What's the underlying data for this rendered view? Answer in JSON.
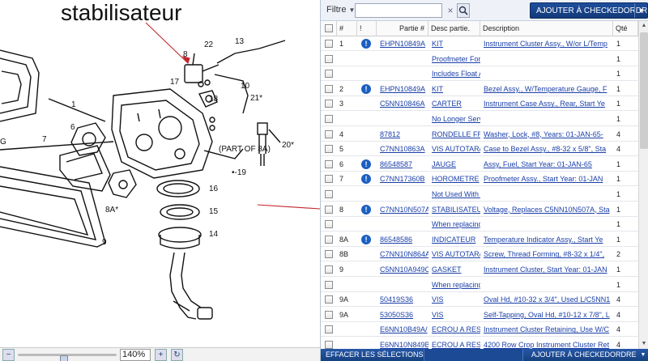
{
  "left": {
    "annotation": "stabilisateur",
    "diagram_labels": [
      "22",
      "13",
      "8",
      "17",
      "10",
      "21*",
      "1",
      "18",
      "6",
      "7",
      "20*",
      "(PART OF 8A)",
      "8A*",
      "16",
      "15",
      "14",
      "9",
      "19",
      "G"
    ],
    "zoom": {
      "value": "140%",
      "zoom_out_icon": "magnifier-minus-icon",
      "zoom_in_icon": "magnifier-plus-icon",
      "refresh_icon": "refresh-icon"
    }
  },
  "toolbar": {
    "filter_label": "Filtre",
    "search_value": "",
    "clear_icon": "×",
    "search_icon": "magnifier-icon",
    "add_to_checkout_label": "AJOUTER À CHECKEDORDRE"
  },
  "columns": [
    "#",
    "!",
    "Partie #",
    "Desc partie.",
    "Description",
    "Qté"
  ],
  "rows": [
    {
      "num": "1",
      "info": true,
      "part": "EHPN10849A",
      "desc": "KIT",
      "description": "Instrument Cluster Assy., W/or L/Temp",
      "qty": "1"
    },
    {
      "num": "",
      "info": false,
      "part": "",
      "desc": "Proofmeter For",
      "description": "",
      "qty": "1"
    },
    {
      "num": "",
      "info": false,
      "part": "",
      "desc": "Includes Float A",
      "description": "",
      "qty": "1"
    },
    {
      "num": "2",
      "info": true,
      "part": "EHPN10849A",
      "desc": "KIT",
      "description": "Bezel Assy., W/Temperature Gauge, F",
      "qty": "1"
    },
    {
      "num": "3",
      "info": false,
      "part": "C5NN10846A",
      "desc": "CARTER",
      "description": "Instrument Case Assy., Rear, Start Ye",
      "qty": "1"
    },
    {
      "num": "",
      "info": false,
      "part": "",
      "desc": "No Longer Serv",
      "description": "",
      "qty": "1"
    },
    {
      "num": "4",
      "info": false,
      "part": "87812",
      "desc": "RONDELLE FRE",
      "description": "Washer, Lock, #8, Years: 01-JAN-65-",
      "qty": "4"
    },
    {
      "num": "5",
      "info": false,
      "part": "C7NN10863A",
      "desc": "VIS AUTOTAR/",
      "description": "Case to Bezel Assy., #8-32 x 5/8\", Sta",
      "qty": "4"
    },
    {
      "num": "6",
      "info": true,
      "part": "86548587",
      "desc": "JAUGE",
      "description": "Assy, Fuel, Start Year: 01-JAN-65",
      "qty": "1"
    },
    {
      "num": "7",
      "info": true,
      "part": "C7NN17360B",
      "desc": "HOROMETRE",
      "description": "Proofmeter Assy., Start Year: 01-JAN",
      "qty": "1"
    },
    {
      "num": "",
      "info": false,
      "part": "",
      "desc": "Not Used With (",
      "description": "",
      "qty": "1"
    },
    {
      "num": "8",
      "info": true,
      "part": "C7NN10N507A",
      "desc": "STABILISATEUI",
      "description": "Voltage, Replaces C5NN10N507A, Sta",
      "qty": "1"
    },
    {
      "num": "",
      "info": false,
      "part": "",
      "desc": "When replacing",
      "description": "",
      "qty": "1"
    },
    {
      "num": "8A",
      "info": true,
      "part": "86548586",
      "desc": "INDICATEUR",
      "description": "Temperature Indicator Assy., Start Ye",
      "qty": "1"
    },
    {
      "num": "8B",
      "info": false,
      "part": "C7NN10N864A",
      "desc": "VIS AUTOTAR/",
      "description": "Screw, Thread Forming, #8-32 x 1/4\",",
      "qty": "2"
    },
    {
      "num": "9",
      "info": false,
      "part": "C5NN10A949C",
      "desc": "GASKET",
      "description": "Instrument Cluster, Start Year: 01-JAN",
      "qty": "1"
    },
    {
      "num": "",
      "info": false,
      "part": "",
      "desc": "When replacing",
      "description": "",
      "qty": "1"
    },
    {
      "num": "9A",
      "info": false,
      "part": "50419S36",
      "desc": "VIS",
      "description": "Oval Hd, #10-32 x 3/4\", Used L/C5NN1",
      "qty": "4"
    },
    {
      "num": "9A",
      "info": false,
      "part": "53050S36",
      "desc": "VIS",
      "description": "Self-Tapping, Oval Hd, #10-12 x 7/8\", L",
      "qty": "4"
    },
    {
      "num": "",
      "info": false,
      "part": "E6NN10B49A/",
      "desc": "ECROU A RESS",
      "description": "Instrument Cluster Retaining, Use W/C",
      "qty": "4"
    },
    {
      "num": "",
      "info": false,
      "part": "E6NN10N849B/",
      "desc": "ECROU A RESS",
      "description": "4200 Row Crop Instrument Cluster Ret",
      "qty": "4"
    }
  ],
  "footer": {
    "clear_selection_label": "EFFACER LES SÉLECTIONS",
    "add_to_checkout_label": "AJOUTER À CHECKEDORDRE"
  }
}
